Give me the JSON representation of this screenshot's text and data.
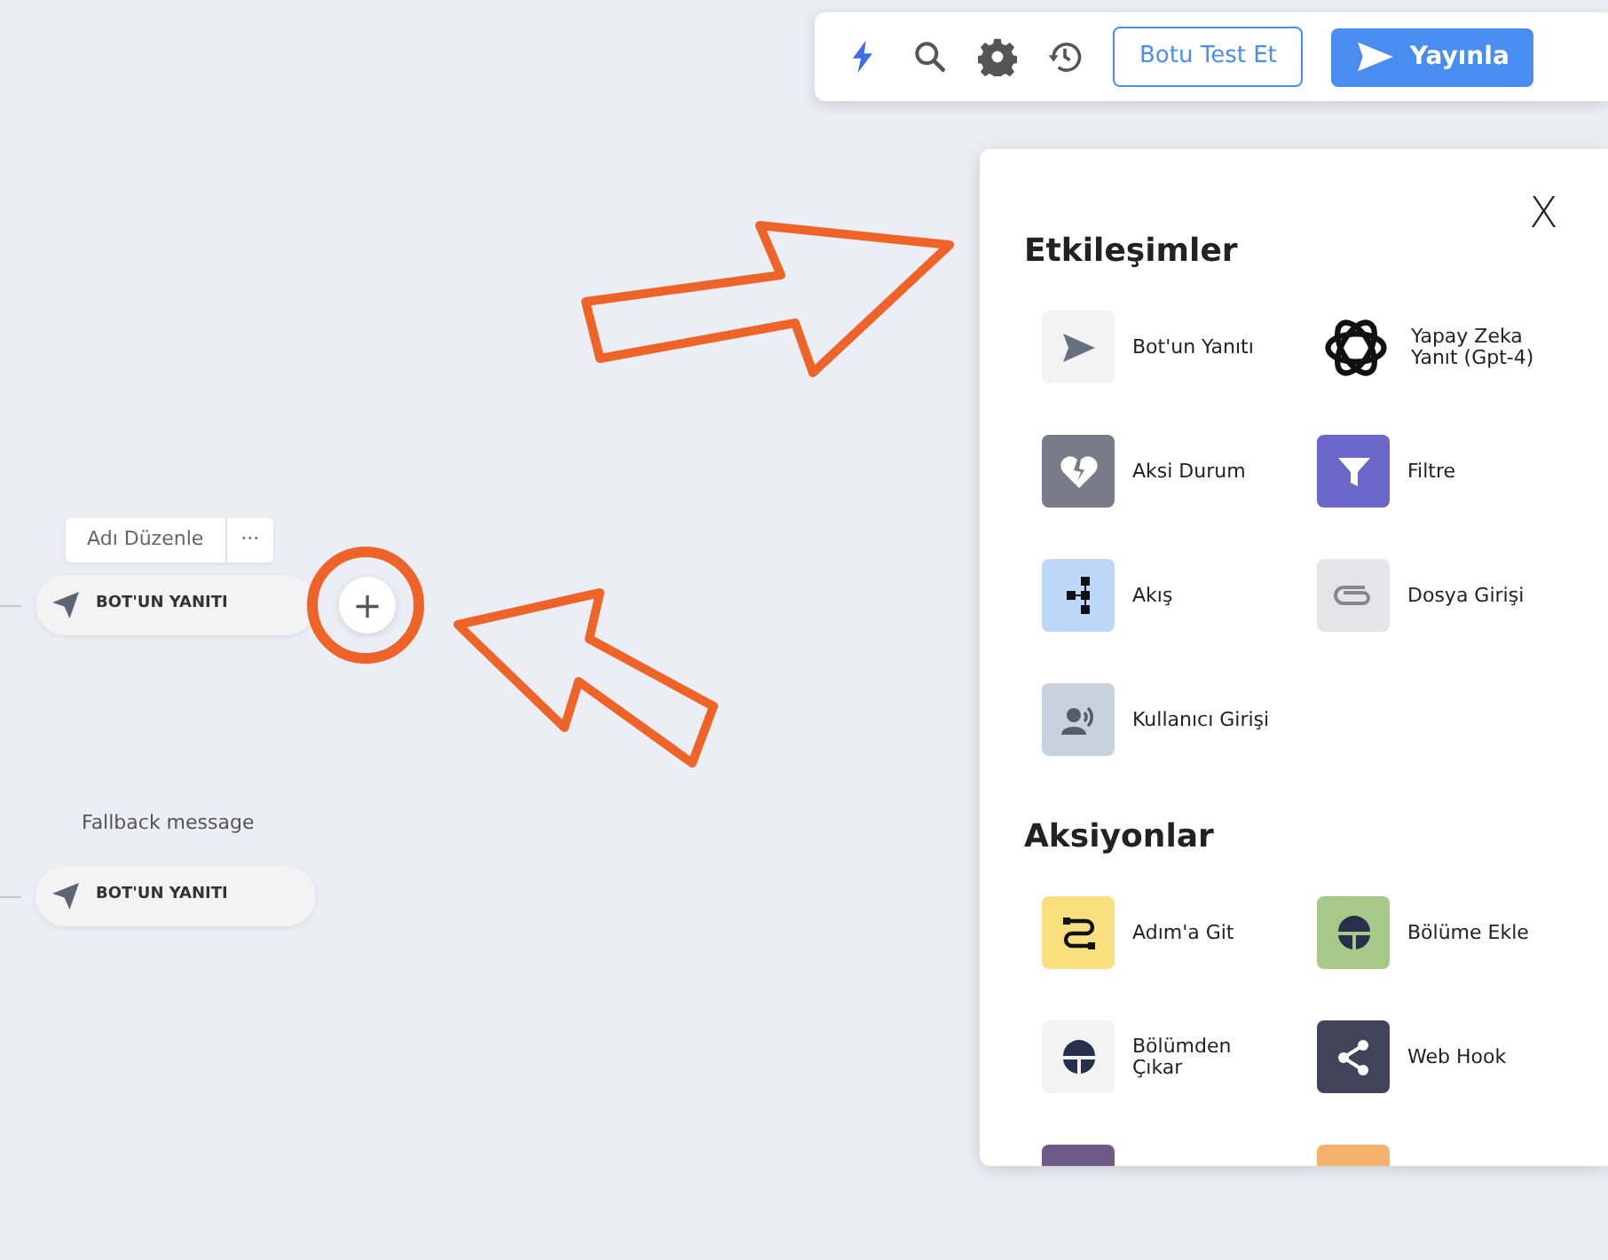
{
  "canvas": {
    "nodes": [
      {
        "caption": "Adı Düzenle",
        "kind": "edit",
        "more": "···",
        "label": "BOT'UN YANITI",
        "add": "+"
      },
      {
        "caption": "Fallback message",
        "kind": "plain",
        "label": "BOT'UN YANITI"
      }
    ]
  },
  "toolbar": {
    "test_button": "Botu Test Et",
    "publish_button": "Yayınla"
  },
  "panel": {
    "close": "X",
    "sections": [
      {
        "title": "Etkileşimler",
        "items": [
          {
            "label": "Bot'un Yanıtı",
            "kind": "send",
            "color": "#f3f3f3"
          },
          {
            "label": "Yapay Zeka Yanıt (Gpt-4)",
            "kind": "knot",
            "color": "#ffffff"
          },
          {
            "label": "Aksi Durum",
            "kind": "heart",
            "color": "#7a7b88"
          },
          {
            "label": "Filtre",
            "kind": "filter",
            "color": "#6c68c9"
          },
          {
            "label": "Akış",
            "kind": "flow",
            "color": "#bcd7f7"
          },
          {
            "label": "Dosya Girişi",
            "kind": "clip",
            "color": "#e5e5e7"
          },
          {
            "label": "Kullanıcı Girişi",
            "kind": "voice",
            "color": "#c8d1dc"
          }
        ]
      },
      {
        "title": "Aksiyonlar",
        "items": [
          {
            "label": "Adım'a Git",
            "kind": "route",
            "color": "#fadf7f"
          },
          {
            "label": "Bölüme Ekle",
            "kind": "section",
            "color": "#a6c98a"
          },
          {
            "label": "Bölümden Çıkar",
            "kind": "section",
            "color": "#f3f3f3"
          },
          {
            "label": "Web Hook",
            "kind": "share",
            "color": "#40435a"
          },
          {
            "kind": "blank",
            "color": "#6e5a86"
          },
          {
            "kind": "blank",
            "color": "#f4b26e"
          }
        ]
      }
    ]
  }
}
